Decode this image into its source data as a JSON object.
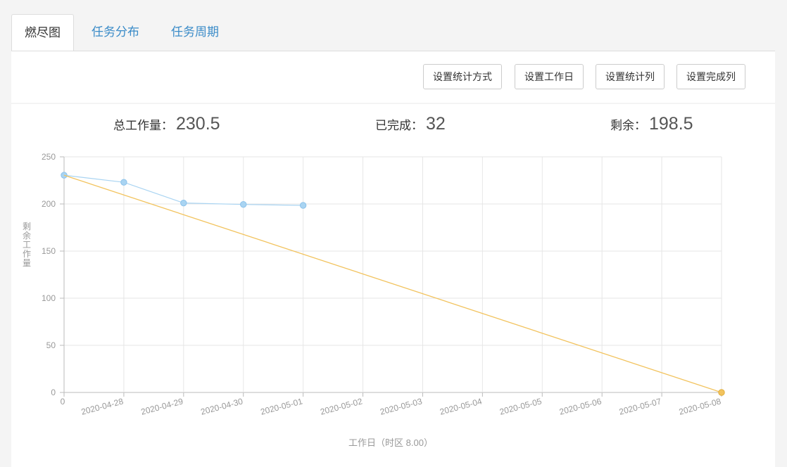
{
  "tabs": [
    {
      "label": "燃尽图",
      "active": true
    },
    {
      "label": "任务分布",
      "active": false
    },
    {
      "label": "任务周期",
      "active": false
    }
  ],
  "toolbar": {
    "buttons": [
      "设置统计方式",
      "设置工作日",
      "设置统计列",
      "设置完成列"
    ]
  },
  "stats": {
    "total_label": "总工作量：",
    "total_value": "230.5",
    "done_label": "已完成：",
    "done_value": "32",
    "remaining_label": "剩余：",
    "remaining_value": "198.5"
  },
  "colors": {
    "actual": "#a9d4f2",
    "ideal": "#f2c35e",
    "accent": "#3a8bc8"
  },
  "chart_data": {
    "type": "line",
    "x": [
      "0",
      "2020-04-28",
      "2020-04-29",
      "2020-04-30",
      "2020-05-01",
      "2020-05-02",
      "2020-05-03",
      "2020-05-04",
      "2020-05-05",
      "2020-05-06",
      "2020-05-07",
      "2020-05-08"
    ],
    "series": [
      {
        "key": "actual",
        "values": [
          230.5,
          223,
          201,
          199.5,
          198.5
        ]
      },
      {
        "key": "ideal",
        "values": [
          230.5,
          null,
          null,
          null,
          null,
          null,
          null,
          null,
          null,
          null,
          null,
          0
        ]
      }
    ],
    "xlabel": "工作日（时区 8.00）",
    "ylabel": "剩余工作量",
    "ylim": [
      0,
      250
    ],
    "yticks": [
      0,
      50,
      100,
      150,
      200,
      250
    ],
    "grid": true
  }
}
